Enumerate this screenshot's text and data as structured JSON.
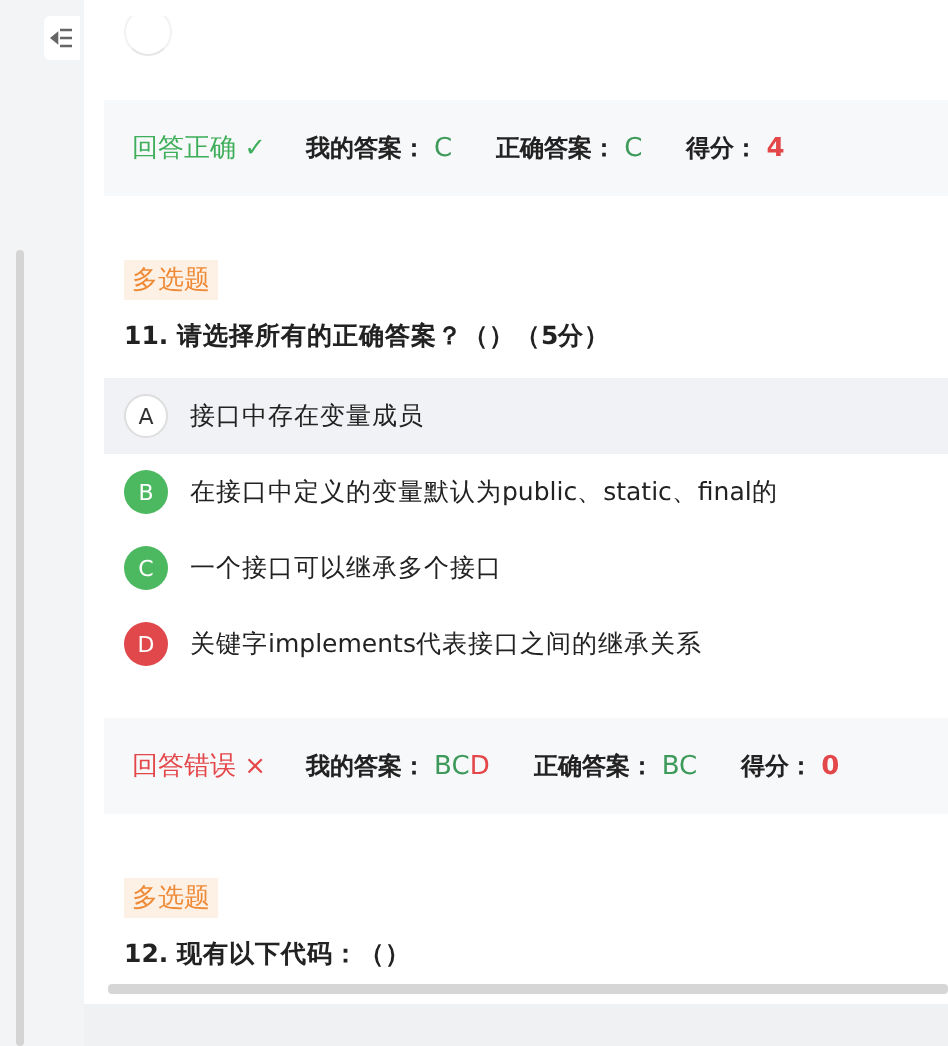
{
  "results_top": {
    "correct": true,
    "status": "回答正确",
    "status_mark": "✓",
    "my_answer_label": "我的答案：",
    "my_answer": [
      {
        "text": "C",
        "correct": true
      }
    ],
    "correct_answer_label": "正确答案：",
    "correct_answer": "C",
    "score_label": "得分：",
    "score": "4"
  },
  "questions": [
    {
      "type_tag": "多选题",
      "title": "11. 请选择所有的正确答案？（）（5分）",
      "options": [
        {
          "letter": "A",
          "text": "接口中存在变量成员",
          "chosen": false,
          "hovered": true
        },
        {
          "letter": "B",
          "text": "在接口中定义的变量默认为public、static、final的",
          "chosen": true,
          "correct": true,
          "hovered": false
        },
        {
          "letter": "C",
          "text": "一个接口可以继承多个接口",
          "chosen": true,
          "correct": true,
          "hovered": false
        },
        {
          "letter": "D",
          "text": "关键字implements代表接口之间的继承关系",
          "chosen": true,
          "correct": false,
          "hovered": false
        }
      ],
      "result": {
        "correct": false,
        "status": "回答错误",
        "status_mark": "×",
        "my_answer_label": "我的答案：",
        "my_answer": [
          {
            "text": "BC",
            "correct": true
          },
          {
            "text": "D",
            "correct": false
          }
        ],
        "correct_answer_label": "正确答案：",
        "correct_answer": "BC",
        "score_label": "得分：",
        "score": "0"
      }
    },
    {
      "type_tag": "多选题",
      "title": "12. 现有以下代码：（）"
    }
  ]
}
